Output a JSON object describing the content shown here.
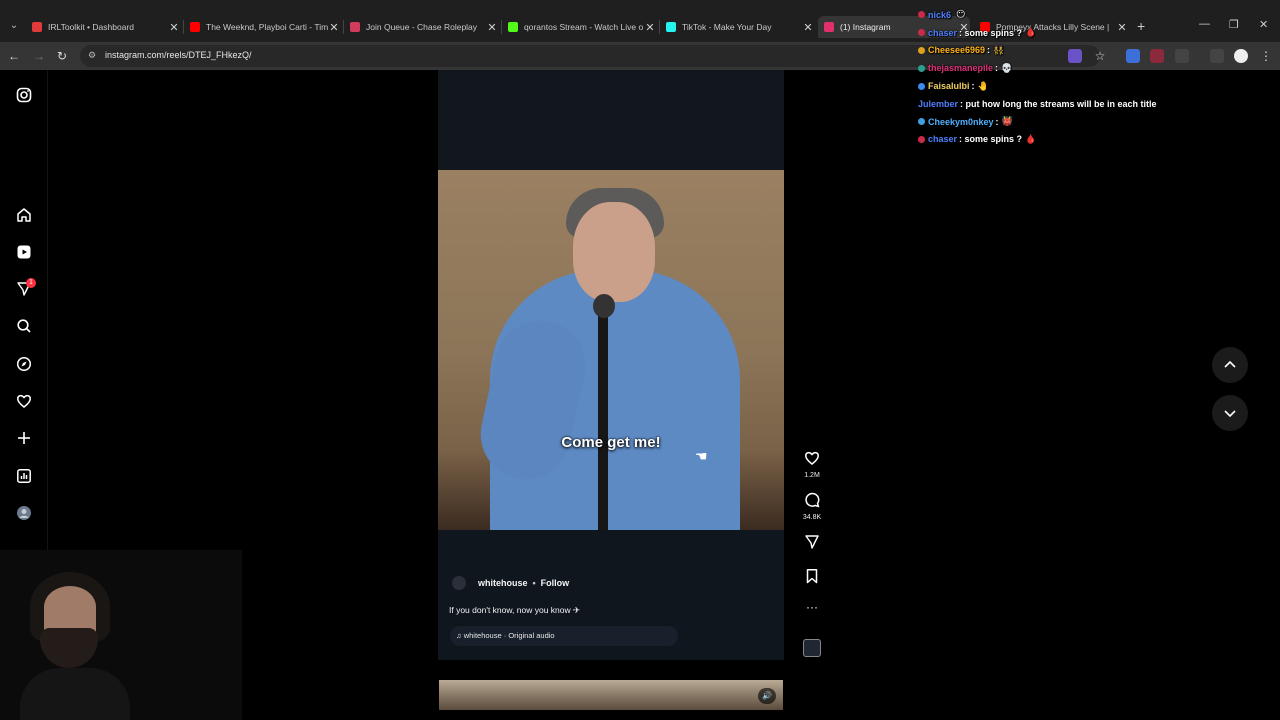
{
  "browser": {
    "tabs": [
      {
        "title": "IRLToolkit • Dashboard",
        "favicon_color": "#e03a3a"
      },
      {
        "title": "The Weeknd, Playboi Carti - Tim",
        "favicon_color": "#ff0000"
      },
      {
        "title": "Join Queue - Chase Roleplay",
        "favicon_color": "#d23c5c"
      },
      {
        "title": "qorantos Stream - Watch Live o",
        "favicon_color": "#53fc18"
      },
      {
        "title": "TikTok - Make Your Day",
        "favicon_color": "#25f4ee"
      },
      {
        "title": "(1) Instagram",
        "favicon_color": "#e1306c",
        "active": true
      },
      {
        "title": "Pompeyx Attacks Lilly Scene |",
        "favicon_color": "#ff0000"
      }
    ],
    "url": "instagram.com/reels/DTEJ_FHkezQ/"
  },
  "instagram": {
    "sidebar": {
      "icons": [
        "instagram-logo-icon",
        "home-icon",
        "reels-icon",
        "messages-icon",
        "search-icon",
        "explore-icon",
        "notifications-icon",
        "create-icon",
        "dashboard-icon",
        "profile-avatar-icon"
      ],
      "notification_count": "1"
    },
    "reel": {
      "caption_overlay": "Come get me!",
      "author": "whitehouse",
      "follow_label": "Follow",
      "post_caption": "If you don't know, now you know ✈",
      "audio_label": "♫ whitehouse · Original audio",
      "likes": "1.2M",
      "comments": "34.8K"
    }
  },
  "chat": [
    {
      "user": "nick6",
      "color": "#4f7fff",
      "badge": "#cc2a4a",
      "message": "",
      "emote": "😶"
    },
    {
      "user": "chaser",
      "color": "#4f7fff",
      "badge": "#cc2a4a",
      "message": ": some spins ?",
      "emote": "🩸"
    },
    {
      "user": "Cheesee6969",
      "color": "#ffb31a",
      "badge": "#e0a020",
      "message": " :",
      "emote": "👯"
    },
    {
      "user": "thejasmanepile",
      "color": "#e0307a",
      "badge": "#2aa090",
      "message": " :",
      "emote": "💀"
    },
    {
      "user": "Faisalulbi",
      "color": "#f0d060",
      "badge": "#3c8cf0",
      "message": " :",
      "emote": "🤚"
    },
    {
      "user": "Julember",
      "color": "#4f7fff",
      "badge": "",
      "message": ": put how long the streams will be in each title",
      "emote": ""
    },
    {
      "user": "Cheekym0nkey",
      "color": "#4fb0ff",
      "badge": "#3fa0e0",
      "message": " :",
      "emote": "👹"
    },
    {
      "user": "chaser",
      "color": "#4f7fff",
      "badge": "#cc2a4a",
      "message": ": some spins ?",
      "emote": "🩸"
    }
  ]
}
